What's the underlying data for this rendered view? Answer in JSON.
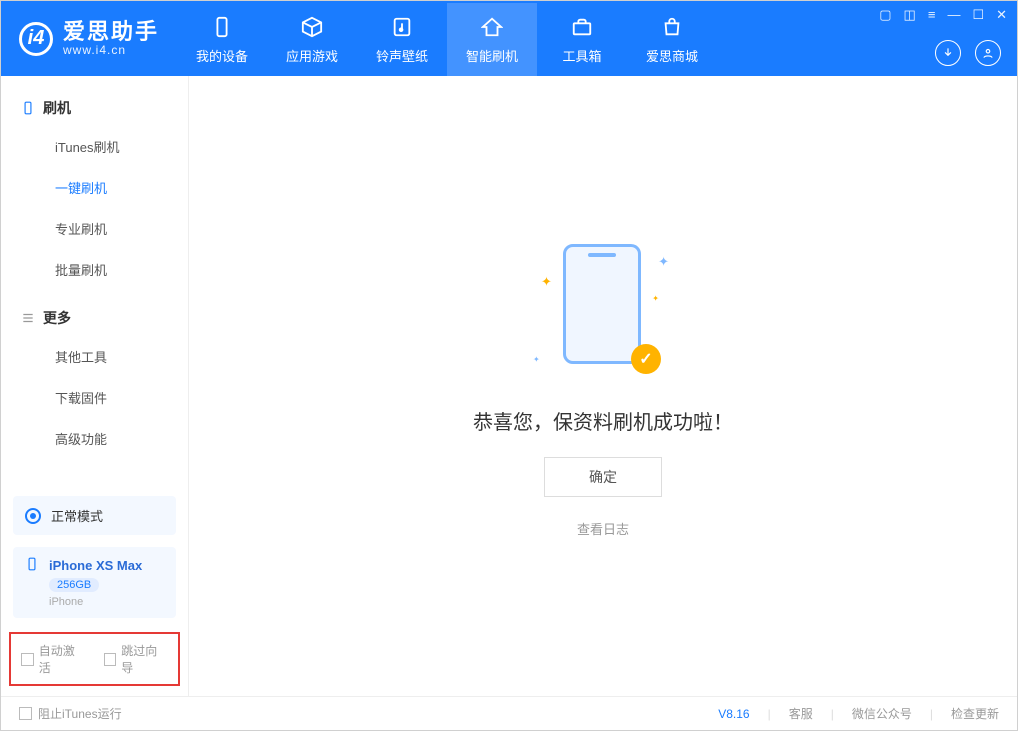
{
  "app": {
    "title": "爱思助手",
    "subtitle": "www.i4.cn"
  },
  "nav": {
    "items": [
      {
        "label": "我的设备"
      },
      {
        "label": "应用游戏"
      },
      {
        "label": "铃声壁纸"
      },
      {
        "label": "智能刷机"
      },
      {
        "label": "工具箱"
      },
      {
        "label": "爱思商城"
      }
    ]
  },
  "sidebar": {
    "flash_title": "刷机",
    "flash_items": [
      {
        "label": "iTunes刷机"
      },
      {
        "label": "一键刷机"
      },
      {
        "label": "专业刷机"
      },
      {
        "label": "批量刷机"
      }
    ],
    "more_title": "更多",
    "more_items": [
      {
        "label": "其他工具"
      },
      {
        "label": "下载固件"
      },
      {
        "label": "高级功能"
      }
    ],
    "mode_label": "正常模式",
    "device": {
      "name": "iPhone XS Max",
      "capacity": "256GB",
      "type": "iPhone"
    },
    "option_auto_activate": "自动激活",
    "option_skip_guide": "跳过向导"
  },
  "main": {
    "result_text": "恭喜您，保资料刷机成功啦！",
    "ok_button": "确定",
    "view_log": "查看日志"
  },
  "footer": {
    "block_itunes": "阻止iTunes运行",
    "version": "V8.16",
    "customer_service": "客服",
    "wechat": "微信公众号",
    "check_update": "检查更新"
  }
}
